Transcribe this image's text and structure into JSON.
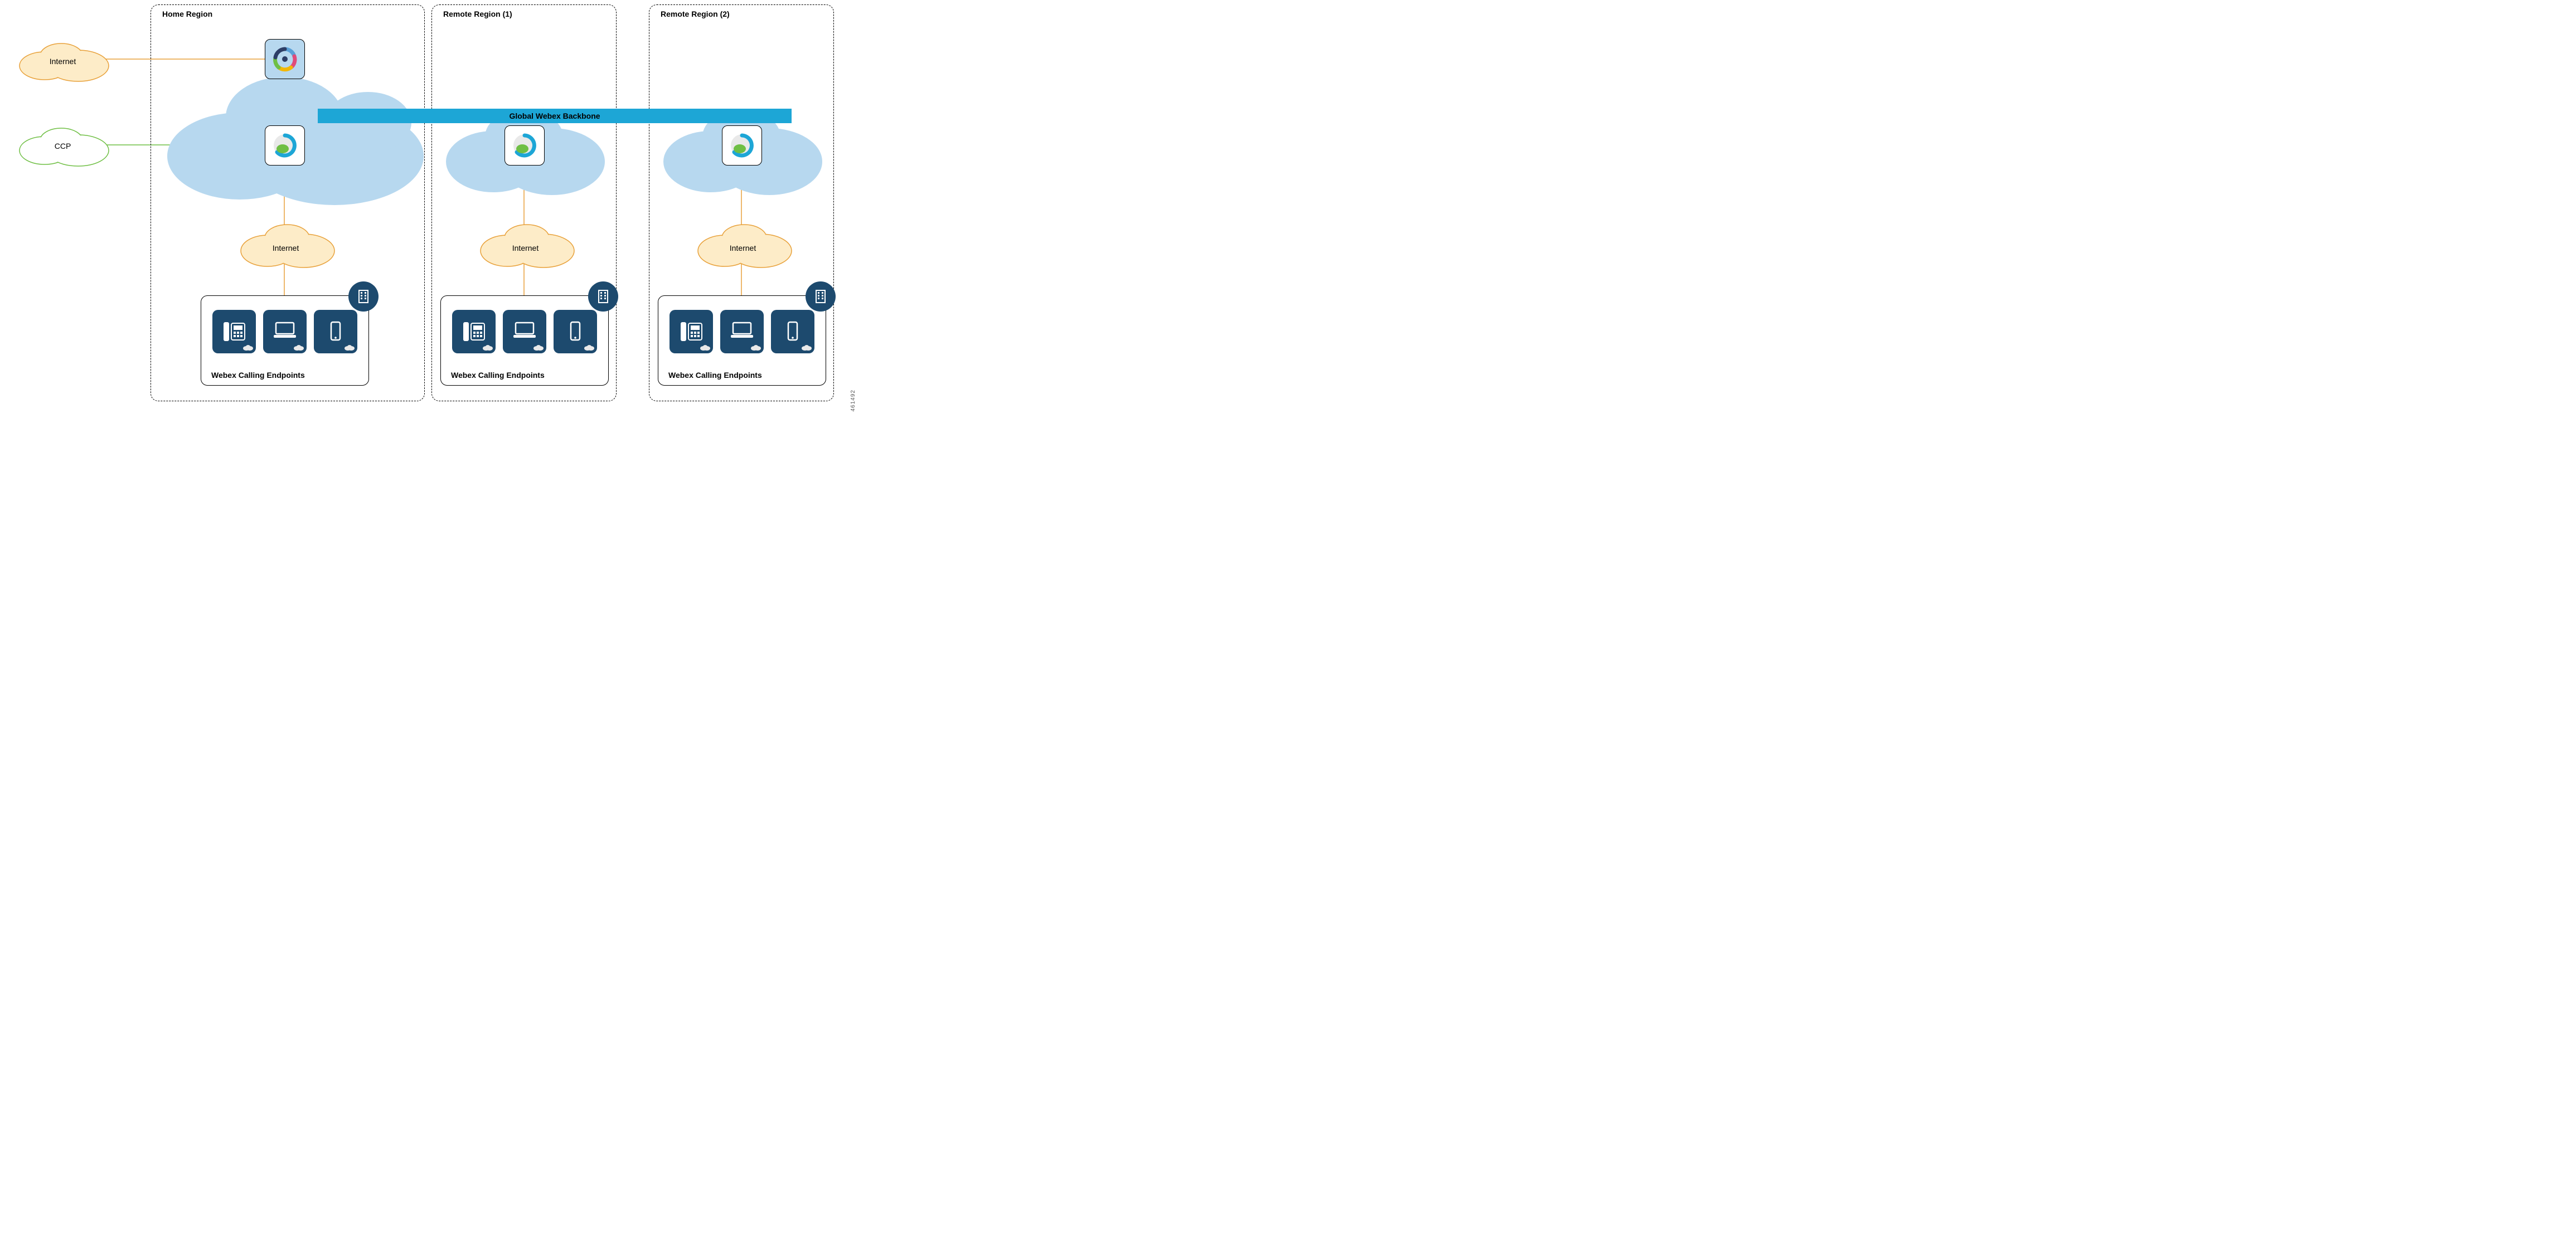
{
  "regions": {
    "home": {
      "title": "Home Region"
    },
    "remote1": {
      "title": "Remote Region (1)"
    },
    "remote2": {
      "title": "Remote Region (2)"
    }
  },
  "clouds": {
    "internet_ext": "Internet",
    "ccp": "CCP",
    "internet_home": "Internet",
    "internet_r1": "Internet",
    "internet_r2": "Internet"
  },
  "backbone": {
    "label": "Global Webex Backbone"
  },
  "endpoints": {
    "home": {
      "label": "Webex Calling Endpoints"
    },
    "remote1": {
      "label": "Webex Calling Endpoints"
    },
    "remote2": {
      "label": "Webex Calling Endpoints"
    }
  },
  "icons": {
    "control_hub": "control-hub-icon",
    "webex": "webex-icon",
    "deskphone": "deskphone-icon",
    "laptop": "laptop-icon",
    "mobile": "mobile-icon",
    "building": "building-icon"
  },
  "colors": {
    "cloud_blue": "#b7d8ef",
    "cloud_orange_fill": "#fdecc8",
    "cloud_orange_stroke": "#e8a13a",
    "line_orange": "#e8a13a",
    "line_green": "#6fbf44",
    "device_bg": "#1d4a6e",
    "backbone": "#1da6d6"
  },
  "watermark": "461492"
}
